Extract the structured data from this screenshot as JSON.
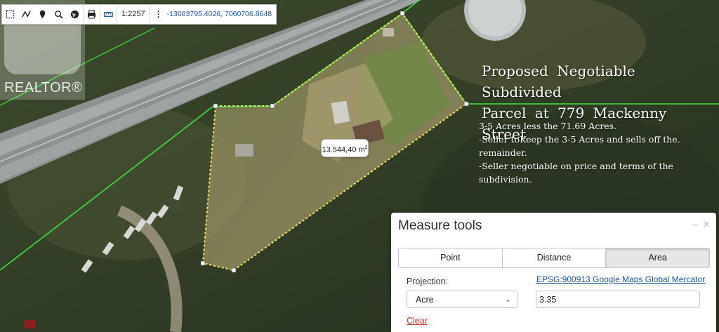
{
  "toolbar": {
    "tools": [
      {
        "name": "select-area-icon"
      },
      {
        "name": "draw-line-icon"
      },
      {
        "name": "location-pin-icon"
      },
      {
        "name": "zoom-icon"
      },
      {
        "name": "globe-icon"
      },
      {
        "name": "print-icon"
      },
      {
        "name": "measure-ruler-icon"
      }
    ],
    "scale": "1:2257",
    "coordinates": "-13083795.4026, 7060706.8648"
  },
  "logo": {
    "wordmark": "REALTOR®"
  },
  "annotation": {
    "headline_line1": "Proposed  Negotiable  Subdivided",
    "headline_line2": "Parcel at 779 Mackenny Street",
    "note1": "3-5 Acres less the 71.69 Acres.",
    "note2": "-Seller toKeep the 3-5 Acres and sells off the. remainder.",
    "note3": "-Seller negotiable on price and terms of the subdivision."
  },
  "map": {
    "area_label_value": "13.544,40 m",
    "area_label_unit_sup": "2"
  },
  "measure": {
    "title": "Measure tools",
    "minimize": "–",
    "close": "×",
    "tabs": [
      "Point",
      "Distance",
      "Area"
    ],
    "active_tab": "Area",
    "projection_label": "Projection:",
    "projection_link": "EPSG:900913 Google Maps Global Mercator",
    "unit": "Acre",
    "value": "3.35",
    "clear": "Clear"
  },
  "colors": {
    "boundary_green": "#3ce63c",
    "parcel_outline": "#f5e65a",
    "link_blue": "#1b57a8",
    "clear_red": "#c0392b"
  }
}
